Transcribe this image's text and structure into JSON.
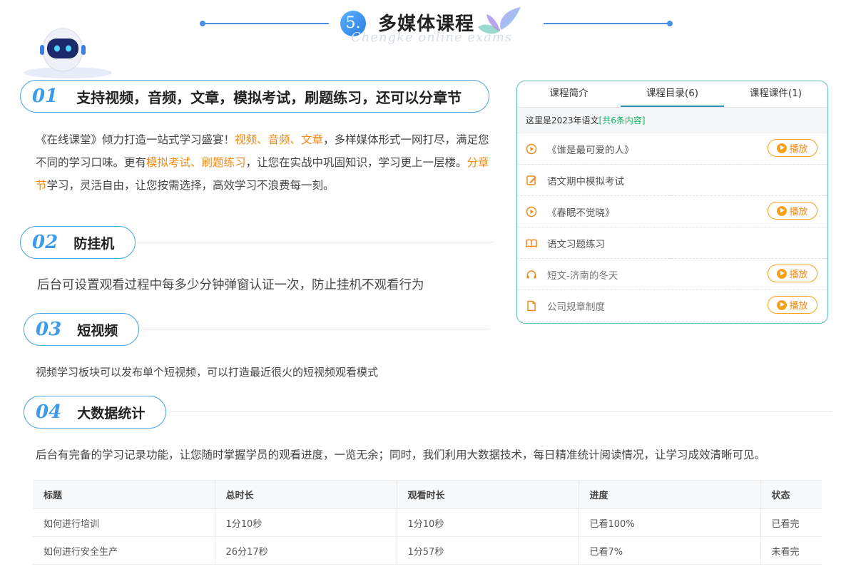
{
  "header": {
    "number": "5.",
    "title": "多媒体课程",
    "subtitle": "Chengke online exams"
  },
  "sections": [
    {
      "num": "01",
      "title": "支持视频，音频，文章，模拟考试，刷题练习，还可以分章节",
      "desc": {
        "p1": "《在线课堂》倾力打造一站式学习盛宴！",
        "h1": "视频、音频、文章",
        "p2": "，多样媒体形式一网打尽，满足您不同的学习口味。更有",
        "h2": "模拟考试、刷题练习",
        "p3": "，让您在实战中巩固知识，学习更上一层楼。",
        "h3": "分章节",
        "p4": "学习，灵活自由，让您按需选择，高效学习不浪费每一刻。"
      }
    },
    {
      "num": "02",
      "title": "防挂机",
      "desc": "后台可设置观看过程中每多少分钟弹窗认证一次，防止挂机不观看行为"
    },
    {
      "num": "03",
      "title": "短视频",
      "desc": "视频学习板块可以发布单个短视频，可以打造最近很火的短视频观看模式"
    },
    {
      "num": "04",
      "title": "大数据统计",
      "desc": "后台有完备的学习记录功能，让您随时掌握学员的观看进度，一览无余；同时，我们利用大数据技术，每日精准统计阅读情况，让学习成效清晰可见。"
    }
  ],
  "course_panel": {
    "tabs": [
      "课程简介",
      "课程目录(6)",
      "课程课件(1)"
    ],
    "active_tab": 1,
    "info_text": "这里是2023年语文",
    "info_highlight": "[共6条内容]",
    "play_label": "播放",
    "items": [
      {
        "icon": "play-circle-icon",
        "name": "《谁是最可爱的人》",
        "play": true
      },
      {
        "icon": "exam-edit-icon",
        "name": "语文期中模拟考试",
        "play": false
      },
      {
        "icon": "play-circle-icon",
        "name": "《春眠不觉晓》",
        "play": true
      },
      {
        "icon": "book-open-icon",
        "name": "语文习题练习",
        "play": false
      },
      {
        "icon": "headphones-icon",
        "name": "短文-济南的冬天",
        "play": true
      },
      {
        "icon": "document-icon",
        "name": "公司规章制度",
        "play": true
      }
    ]
  },
  "stats_table": {
    "headers": [
      "标题",
      "总时长",
      "观看时长",
      "进度",
      "状态"
    ],
    "rows": [
      [
        "如何进行培训",
        "1分10秒",
        "1分10秒",
        "已看100%",
        "已看完"
      ],
      [
        "如何进行安全生产",
        "26分17秒",
        "1分57秒",
        "已看7%",
        "未看完"
      ]
    ]
  },
  "colors": {
    "accent": "#3d9be9",
    "highlight": "#f08a16",
    "panel_border": "#5cbfb4",
    "info_green": "#1bb36a"
  }
}
